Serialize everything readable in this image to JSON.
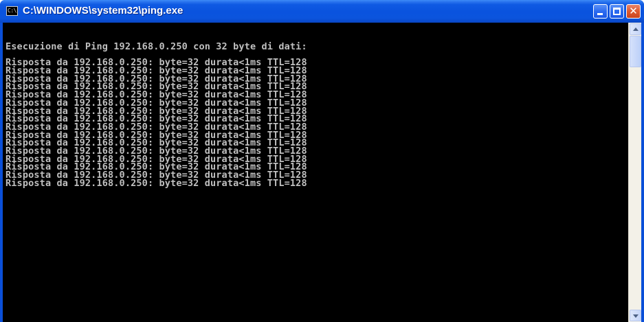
{
  "window": {
    "title": "C:\\WINDOWS\\system32\\ping.exe",
    "icon_text": "C:\\",
    "colors": {
      "titlebar": "#0a53de",
      "console_background": "#000000",
      "console_text": "#c0c0c0",
      "close_button": "#de5a2f"
    }
  },
  "controls": {
    "minimize_icon": "minimize-icon",
    "maximize_icon": "maximize-icon",
    "close_icon": "close-icon",
    "close_glyph": "✕"
  },
  "console": {
    "lines": [
      "Esecuzione di Ping 192.168.0.250 con 32 byte di dati:",
      "",
      "Risposta da 192.168.0.250: byte=32 durata<1ms TTL=128",
      "Risposta da 192.168.0.250: byte=32 durata<1ms TTL=128",
      "Risposta da 192.168.0.250: byte=32 durata<1ms TTL=128",
      "Risposta da 192.168.0.250: byte=32 durata<1ms TTL=128",
      "Risposta da 192.168.0.250: byte=32 durata<1ms TTL=128",
      "Risposta da 192.168.0.250: byte=32 durata<1ms TTL=128",
      "Risposta da 192.168.0.250: byte=32 durata<1ms TTL=128",
      "Risposta da 192.168.0.250: byte=32 durata<1ms TTL=128",
      "Risposta da 192.168.0.250: byte=32 durata<1ms TTL=128",
      "Risposta da 192.168.0.250: byte=32 durata<1ms TTL=128",
      "Risposta da 192.168.0.250: byte=32 durata<1ms TTL=128",
      "Risposta da 192.168.0.250: byte=32 durata<1ms TTL=128",
      "Risposta da 192.168.0.250: byte=32 durata<1ms TTL=128",
      "Risposta da 192.168.0.250: byte=32 durata<1ms TTL=128",
      "Risposta da 192.168.0.250: byte=32 durata<1ms TTL=128",
      "Risposta da 192.168.0.250: byte=32 durata<1ms TTL=128"
    ]
  },
  "scrollbar": {
    "up_icon": "scroll-up-arrow-icon",
    "down_icon": "scroll-down-arrow-icon"
  }
}
